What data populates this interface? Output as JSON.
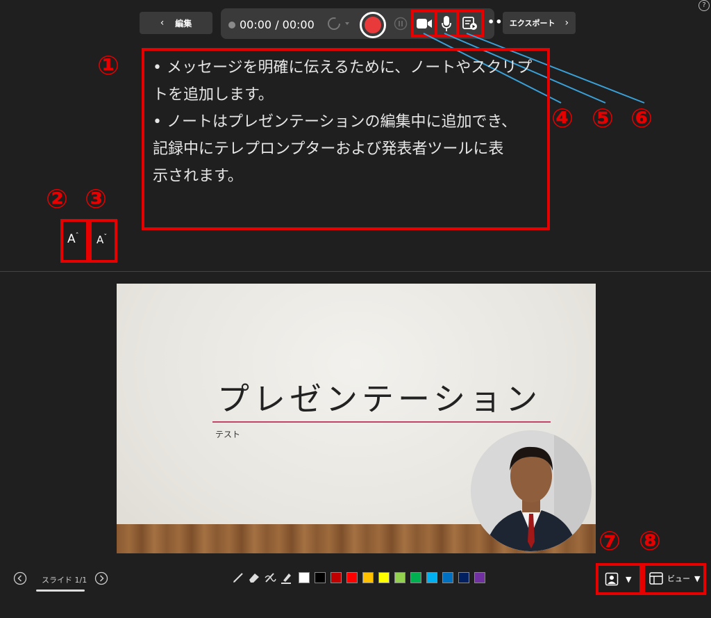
{
  "header": {
    "back_label": "編集",
    "timer": "00:00 / 00:00",
    "export_label": "エクスポート",
    "help_label": "?"
  },
  "notes": {
    "lines": [
      "• メッセージを明確に伝えるために、ノートやスクリプ",
      "トを追加します。",
      "• ノートはプレゼンテーションの編集中に追加でき、",
      "記録中にテレプロンプターおよび発表者ツールに表",
      "示されます。"
    ],
    "font_increase_label": "A",
    "font_decrease_label": "A"
  },
  "annotations": {
    "n1": "①",
    "n2": "②",
    "n3": "③",
    "n4": "④",
    "n5": "⑤",
    "n6": "⑥",
    "n7": "⑦",
    "n8": "⑧"
  },
  "slide": {
    "title": "プレゼンテーション",
    "subtitle": "テスト"
  },
  "footer": {
    "slide_counter": "スライド 1/1",
    "view_label": "ビュー",
    "colors": [
      "#ffffff",
      "#000000",
      "#c00000",
      "#ff0000",
      "#ffc000",
      "#ffff00",
      "#92d050",
      "#00b050",
      "#00b0f0",
      "#0070c0",
      "#002060",
      "#7030a0"
    ]
  },
  "accent": {
    "record_red": "#e83a3a",
    "highlight_red": "#e60000",
    "callout_line": "#3aa0d8"
  }
}
